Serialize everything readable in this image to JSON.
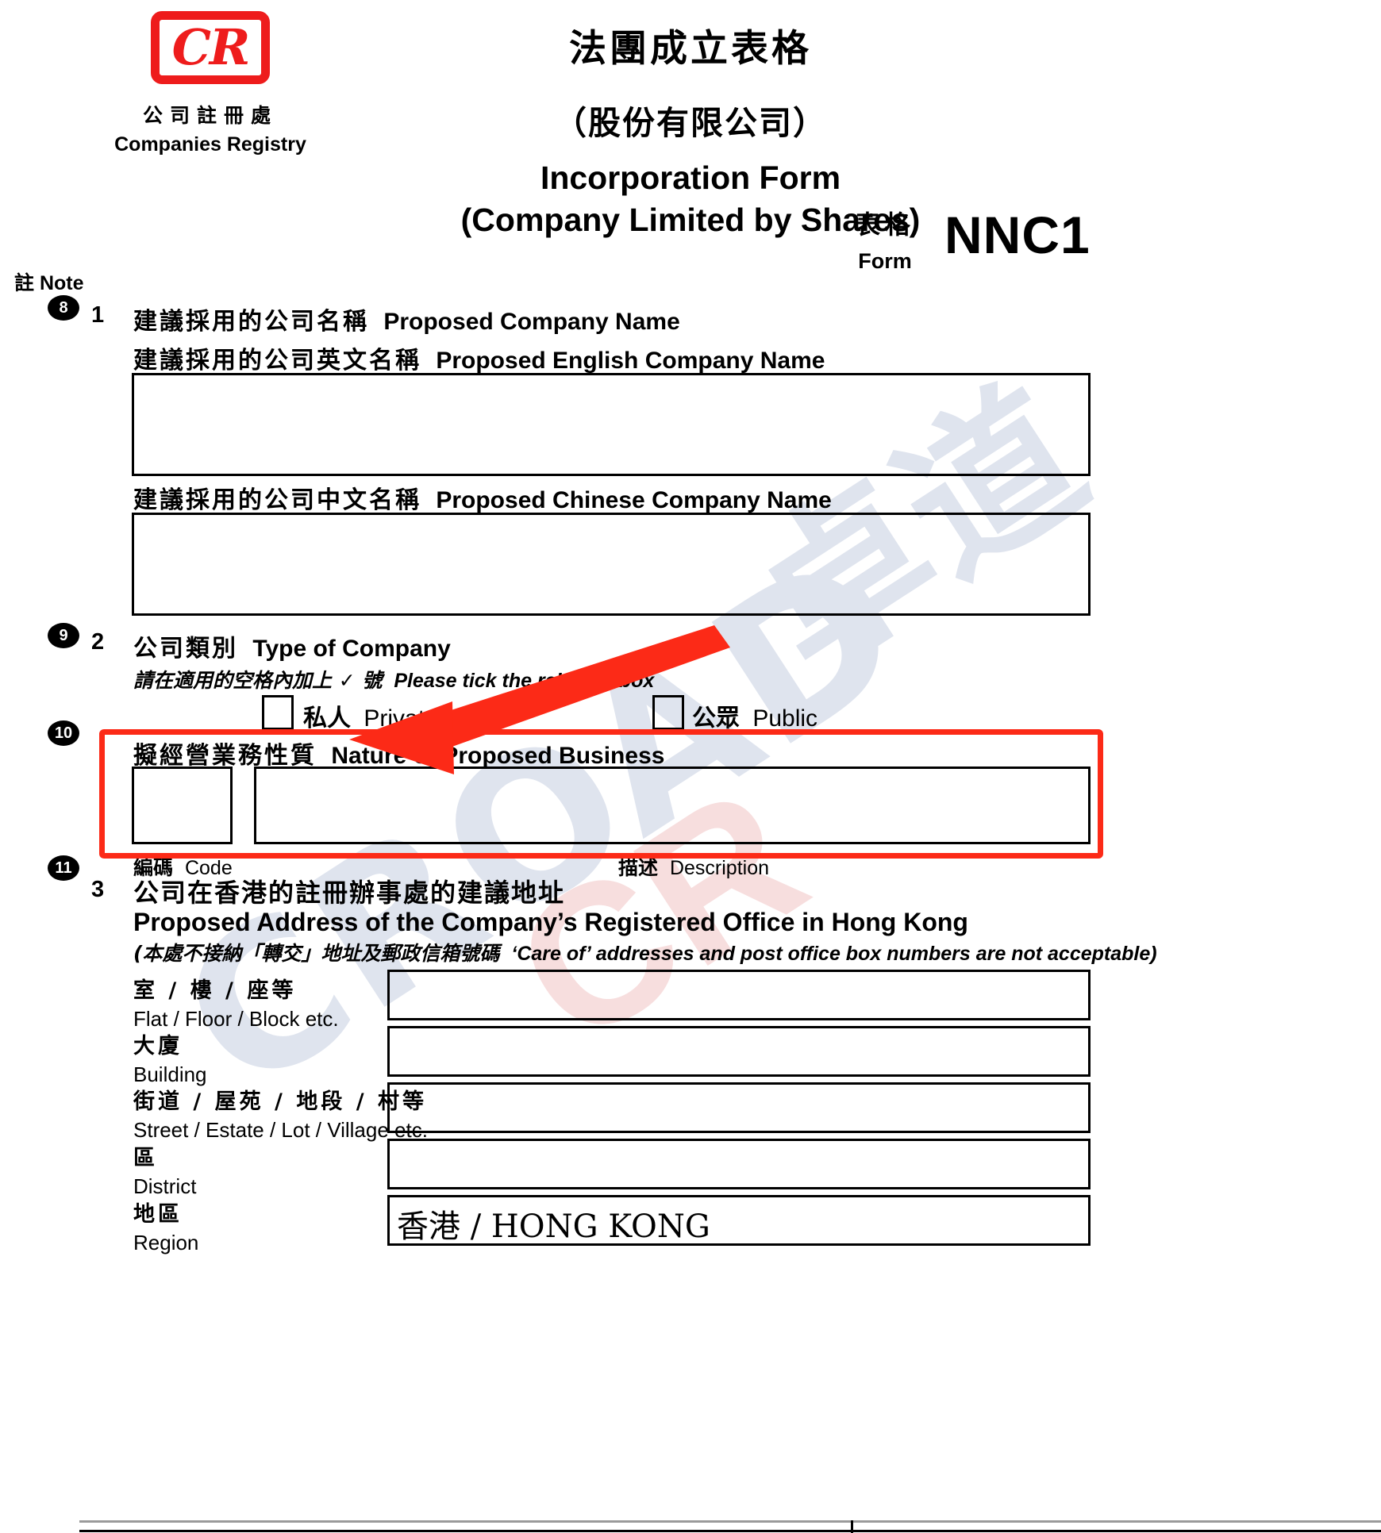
{
  "document": {
    "form_code": "NNC1",
    "form_label_cn": "表格",
    "form_label_en": "Form",
    "title_cn": "法團成立表格",
    "subtitle_cn": "（股份有限公司）",
    "title_en": "Incorporation Form",
    "subtitle_en": "(Company Limited by Shares)"
  },
  "logo": {
    "mark": "CR",
    "org_cn": "公司註冊處",
    "org_en": "Companies Registry"
  },
  "watermark": {
    "latin": "CROAD",
    "cjk": "卓道"
  },
  "note_column": {
    "header_cn": "註",
    "header_en": "Note",
    "bubbles": [
      "8",
      "9",
      "10",
      "11"
    ]
  },
  "sections": {
    "s1": {
      "number": "1",
      "heading_cn": "建議採用的公司名稱",
      "heading_en": "Proposed Company Name",
      "english_name": {
        "label_cn": "建議採用的公司英文名稱",
        "label_en": "Proposed English Company Name",
        "value": ""
      },
      "chinese_name": {
        "label_cn": "建議採用的公司中文名稱",
        "label_en": "Proposed Chinese Company Name",
        "value": ""
      }
    },
    "s2": {
      "number": "2",
      "heading_cn": "公司類別",
      "heading_en": "Type of Company",
      "hint_cn": "請在適用的空格內加上 ✓ 號",
      "hint_en": "Please tick the relevant box",
      "options": [
        {
          "label_cn": "私人",
          "label_en": "Private",
          "checked": false
        },
        {
          "label_cn": "公眾",
          "label_en": "Public",
          "checked": false
        }
      ]
    },
    "s_nature": {
      "heading_cn": "擬經營業務性質",
      "heading_en": "Nature of Proposed Business",
      "code": {
        "label_cn": "編碼",
        "label_en": "Code",
        "value": ""
      },
      "description": {
        "label_cn": "描述",
        "label_en": "Description",
        "value": ""
      }
    },
    "s3": {
      "number": "3",
      "heading_cn": "公司在香港的註冊辦事處的建議地址",
      "heading_en": "Proposed Address of the Company’s Registered Office in Hong Kong",
      "note_cn": "(本處不接納「轉交」地址及郵政信箱號碼",
      "note_en": "‘Care of’ addresses and post office box numbers are not acceptable)",
      "fields": [
        {
          "label_cn": "室 / 樓 / 座等",
          "label_en": "Flat / Floor / Block etc.",
          "value": ""
        },
        {
          "label_cn": "大廈",
          "label_en": "Building",
          "value": ""
        },
        {
          "label_cn": "街道 / 屋苑 / 地段 / 村等",
          "label_en": "Street / Estate / Lot / Village etc.",
          "value": ""
        },
        {
          "label_cn": "區",
          "label_en": "District",
          "value": ""
        },
        {
          "label_cn": "地區",
          "label_en": "Region",
          "value": "香港 / HONG KONG"
        }
      ]
    }
  },
  "annotation": {
    "highlight_color": "#fc2a17",
    "arrow_color": "#fc2a17",
    "target": "Nature of Proposed Business"
  }
}
